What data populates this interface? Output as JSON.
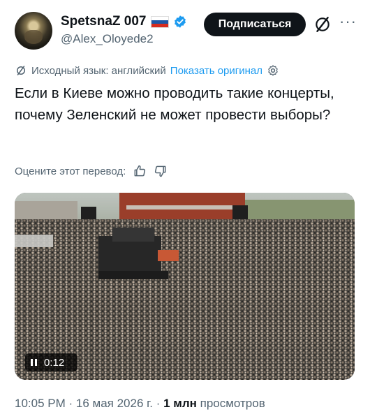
{
  "author": {
    "display_name": "SpetsnaZ 007",
    "handle": "@Alex_Oloyede2",
    "flag": "russia-flag",
    "badge": "verified-icon",
    "badge_color": "#1d9bf0"
  },
  "actions": {
    "subscribe_label": "Подписаться",
    "grok_icon": "slashed-circle-icon",
    "more_label": "···"
  },
  "translation": {
    "source_language": "Исходный язык: английский",
    "show_original": "Показать оригинал"
  },
  "tweet": {
    "text": "Если в Киеве можно проводить такие концерты, почему Зеленский не может провести выборы?"
  },
  "rating": {
    "label": "Оцените этот перевод:"
  },
  "media": {
    "type": "video",
    "duration": "0:12",
    "state": "playing"
  },
  "meta": {
    "time": "10:05 PM",
    "separator": " · ",
    "date": "16 мая 2026 г.",
    "views_count": "1 млн",
    "views_label": " просмотров"
  }
}
